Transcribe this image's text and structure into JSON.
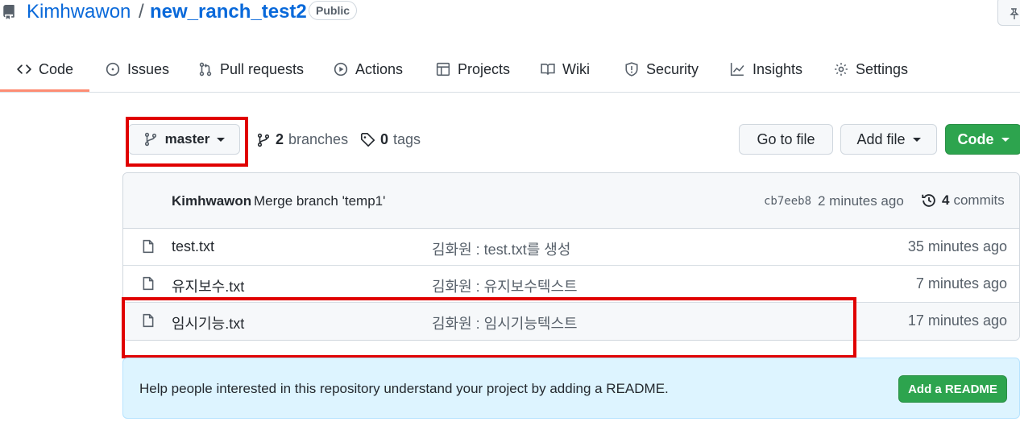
{
  "header": {
    "owner": "Kimhwawon",
    "separator": "/",
    "repo": "new_ranch_test2",
    "visibility": "Public"
  },
  "nav": {
    "tabs": [
      {
        "label": "Code",
        "icon": "code-icon"
      },
      {
        "label": "Issues",
        "icon": "issue-opened-icon"
      },
      {
        "label": "Pull requests",
        "icon": "git-pull-request-icon"
      },
      {
        "label": "Actions",
        "icon": "play-icon"
      },
      {
        "label": "Projects",
        "icon": "table-icon"
      },
      {
        "label": "Wiki",
        "icon": "book-icon"
      },
      {
        "label": "Security",
        "icon": "shield-icon"
      },
      {
        "label": "Insights",
        "icon": "graph-icon"
      },
      {
        "label": "Settings",
        "icon": "gear-icon"
      }
    ],
    "active_tab": "Code",
    "active_color": "#fd8c73"
  },
  "toolbar": {
    "branch": "master",
    "branches_count": "2",
    "branches_label": "branches",
    "tags_count": "0",
    "tags_label": "tags",
    "go_to_file": "Go to file",
    "add_file": "Add file",
    "code": "Code",
    "code_button_color": "#2da44e"
  },
  "latest_commit": {
    "author": "Kimhwawon",
    "message": "Merge branch 'temp1'",
    "sha": "cb7eeb8",
    "age": "2 minutes ago",
    "commits_count": "4",
    "commits_label": "commits"
  },
  "files": [
    {
      "name": "test.txt",
      "message": "김화원 : test.txt를 생성",
      "age": "35 minutes ago"
    },
    {
      "name": "유지보수.txt",
      "message": "김화원 : 유지보수텍스트",
      "age": "7 minutes ago"
    },
    {
      "name": "임시기능.txt",
      "message": "김화원 : 임시기능텍스트",
      "age": "17 minutes ago"
    }
  ],
  "readme_banner": {
    "text": "Help people interested in this repository understand your project by adding a README.",
    "button": "Add a README"
  },
  "annotation_color": "#e00000"
}
